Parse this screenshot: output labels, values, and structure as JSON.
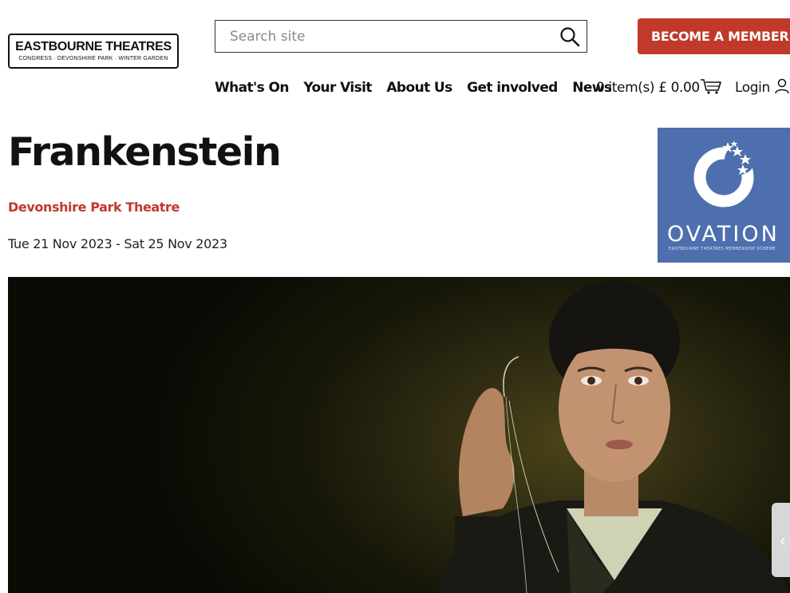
{
  "logo": {
    "title": "EASTBOURNE THEATRES",
    "subtitle": "CONGRESS · DEVONSHIRE PARK · WINTER GARDEN"
  },
  "search": {
    "placeholder": "Search site",
    "icon": "search-icon"
  },
  "member_button": "BECOME A MEMBER",
  "nav": {
    "items": [
      "What's On",
      "Your Visit",
      "About Us",
      "Get involved",
      "News"
    ]
  },
  "cart": {
    "text": "0 item(s) £ 0.00",
    "icon": "basket-icon"
  },
  "login": {
    "label": "Login",
    "icon": "user-icon"
  },
  "event": {
    "title": "Frankenstein",
    "venue": "Devonshire Park Theatre",
    "dates": "Tue 21 Nov 2023 - Sat 25 Nov 2023"
  },
  "ovation": {
    "word": "OVATION",
    "subtitle": "EASTBOURNE THEATRES MEMBERSHIP SCHEME"
  },
  "colors": {
    "brand_red": "#c0392b",
    "ovation_blue": "#4e6fae"
  },
  "side_tab": {
    "icon": "chevron-left-icon",
    "glyph": "‹"
  }
}
